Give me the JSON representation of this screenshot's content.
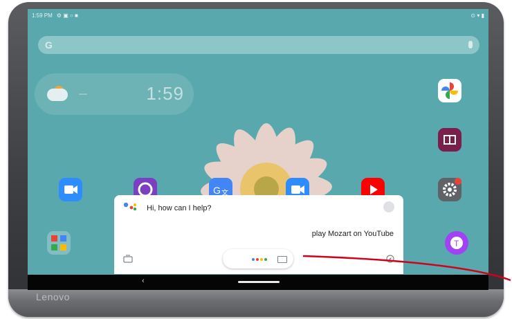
{
  "device": {
    "brand": "Lenovo"
  },
  "status_bar": {
    "time": "1:59 PM"
  },
  "weather_widget": {
    "time": "1:59"
  },
  "assistant": {
    "greeting": "Hi, how can I help?",
    "query": "play Mozart on YouTube"
  },
  "colors": {
    "wallpaper": "#58a8ad",
    "annotation_line": "#d0021b",
    "assistant_blue": "#4285f4",
    "assistant_red": "#ea4335",
    "assistant_yellow": "#fbbc05",
    "assistant_green": "#34a853"
  },
  "icons": {
    "home_apps": [
      "zoom-icon",
      "camera-icon",
      "translate-icon",
      "zoom-video-icon",
      "youtube-icon",
      "google-photos-icon",
      "reading-icon",
      "settings-icon",
      "google-apps-folder-icon",
      "toolbox-icon"
    ],
    "assistant": [
      "google-assistant-icon",
      "profile-icon",
      "lens-icon",
      "keyboard-icon",
      "explore-icon"
    ],
    "navigation": [
      "back-icon",
      "home-pill-icon"
    ]
  }
}
